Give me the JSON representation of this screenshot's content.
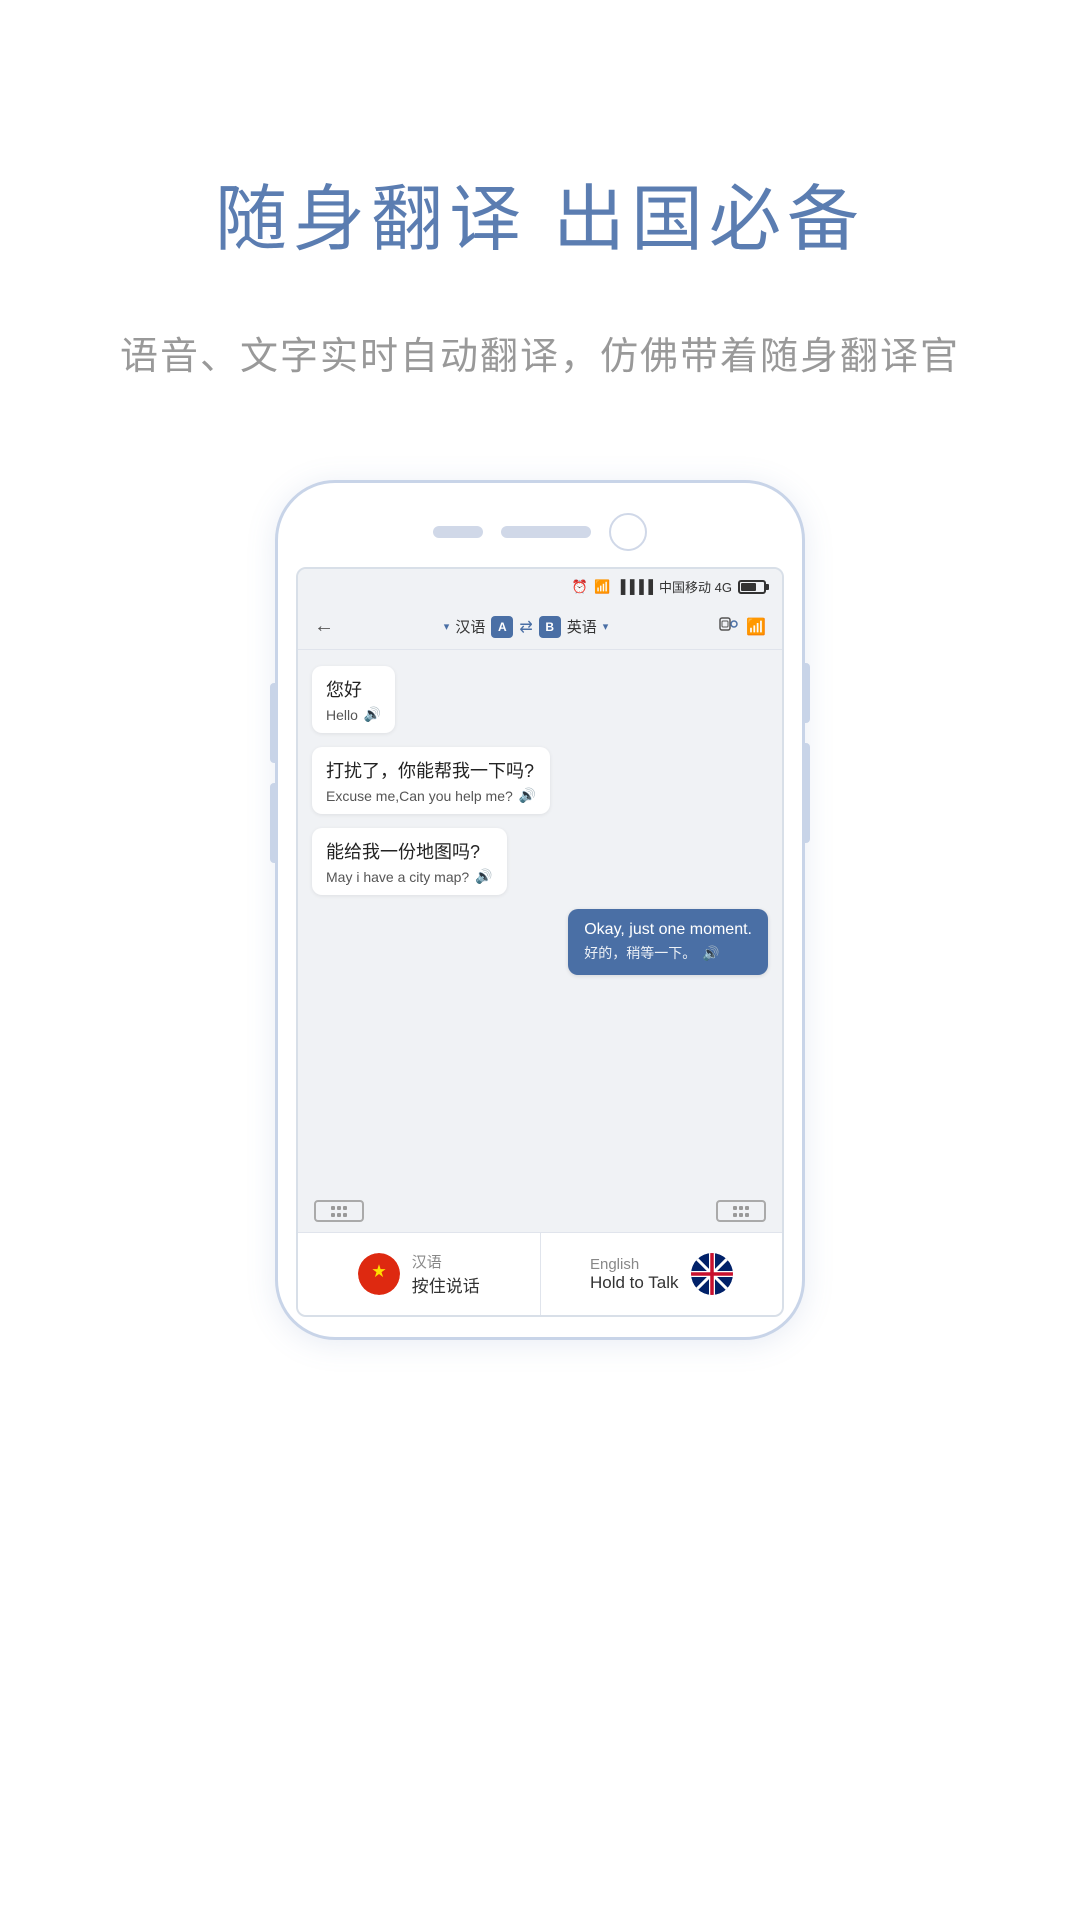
{
  "hero": {
    "title": "随身翻译 出国必备",
    "subtitle": "语音、文字实时自动翻译，仿佛带着随身翻译官"
  },
  "phone": {
    "status_bar": {
      "alarm": "⏰",
      "wifi": "📶",
      "signal": "▐▐▐▐",
      "carrier": "中国移动 4G"
    },
    "nav": {
      "back": "←",
      "lang_a": "汉语",
      "badge_a": "A",
      "swap": "⇄",
      "badge_b": "B",
      "lang_b": "英语",
      "dropdown_left": "▾",
      "dropdown_right": "▾"
    },
    "messages": [
      {
        "id": "msg1",
        "direction": "left",
        "main": "您好",
        "translation": "Hello",
        "has_speaker": true
      },
      {
        "id": "msg2",
        "direction": "left",
        "main": "打扰了，你能帮我一下吗?",
        "translation": "Excuse me,Can you help me?",
        "has_speaker": true
      },
      {
        "id": "msg3",
        "direction": "left",
        "main": "能给我一份地图吗?",
        "translation": "May i have a city map?",
        "has_speaker": true
      },
      {
        "id": "msg4",
        "direction": "right",
        "main": "Okay, just one moment.",
        "translation": "好的，稍等一下。",
        "has_speaker": true
      }
    ],
    "bottom_talk": {
      "left": {
        "lang": "汉语",
        "action": "按住说话"
      },
      "right": {
        "lang": "English",
        "action": "Hold to Talk"
      }
    }
  }
}
